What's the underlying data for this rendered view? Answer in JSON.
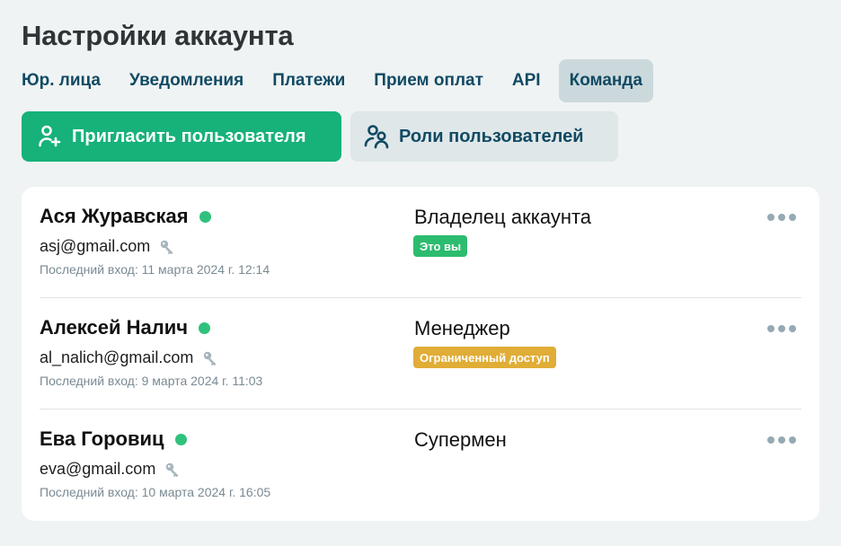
{
  "page": {
    "title": "Настройки аккаунта"
  },
  "tabs": [
    {
      "label": "Юр. лица",
      "active": false
    },
    {
      "label": "Уведомления",
      "active": false
    },
    {
      "label": "Платежи",
      "active": false
    },
    {
      "label": "Прием оплат",
      "active": false
    },
    {
      "label": "API",
      "active": false
    },
    {
      "label": "Команда",
      "active": true
    }
  ],
  "actions": {
    "invite_label": "Пригласить пользователя",
    "invite_icon": "add-user-icon",
    "roles_label": "Роли пользователей",
    "roles_icon": "users-icon"
  },
  "colors": {
    "primary": "#16b27a",
    "online": "#2fc27c",
    "badge_you": "#2cbc6f",
    "badge_limited": "#e0ad36"
  },
  "users": [
    {
      "name": "Ася Журавская",
      "online": true,
      "email": "asj@gmail.com",
      "last_login": "Последний вход: 11 марта 2024 г. 12:14",
      "role": "Владелец аккаунта",
      "badge": "Это вы"
    },
    {
      "name": "Алексей Налич",
      "online": true,
      "email": "al_nalich@gmail.com",
      "last_login": "Последний вход: 9 марта 2024 г. 11:03",
      "role": "Менеджер",
      "badge": "Ограниченный доступ"
    },
    {
      "name": "Ева Горовиц",
      "online": true,
      "email": "eva@gmail.com",
      "last_login": "Последний вход: 10 марта 2024 г. 16:05",
      "role": "Супермен",
      "badge": ""
    }
  ]
}
